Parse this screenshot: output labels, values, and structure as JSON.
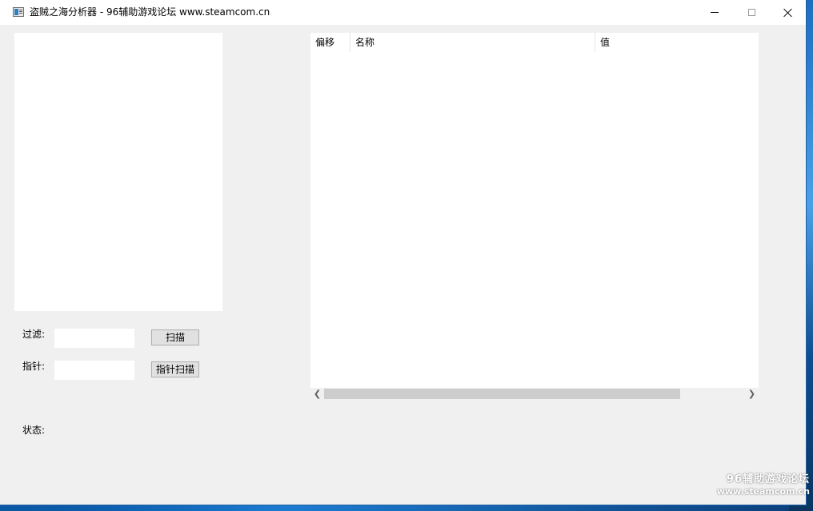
{
  "window": {
    "title": "盗贼之海分析器 - 96辅助游戏论坛 www.steamcom.cn",
    "icon": "app-window-icon"
  },
  "form": {
    "filter_label": "过滤:",
    "filter_value": "",
    "scan_button": "扫描",
    "pointer_label": "指针:",
    "pointer_value": "",
    "pointer_scan_button": "指针扫描",
    "status_label": "状态:"
  },
  "listview": {
    "columns": [
      "偏移",
      "名称",
      "值"
    ],
    "rows": []
  },
  "watermark": {
    "line1": "96辅助游戏论坛",
    "line2": "www.steamcom.cn"
  },
  "colors": {
    "window_bg": "#f0f0f0",
    "titlebar_bg": "#ffffff",
    "desktop_blue": "#0b5cab",
    "scroll_thumb": "#cdcdcd",
    "button_bg": "#e1e1e1"
  }
}
